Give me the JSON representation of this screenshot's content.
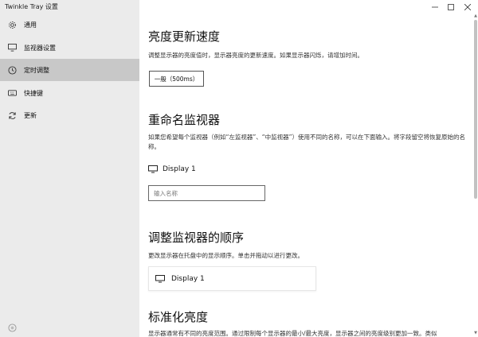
{
  "window": {
    "title": "Twinkle Tray 设置",
    "controls": [
      "minimize-icon",
      "maximize-icon",
      "close-icon"
    ]
  },
  "sidebar": {
    "items": [
      {
        "label": "通用",
        "icon": "gear-icon",
        "active": false
      },
      {
        "label": "监视器设置",
        "icon": "monitor-icon",
        "active": false
      },
      {
        "label": "定时调整",
        "icon": "clock-icon",
        "active": true
      },
      {
        "label": "快捷键",
        "icon": "keyboard-icon",
        "active": false
      },
      {
        "label": "更新",
        "icon": "refresh-icon",
        "active": false
      }
    ],
    "bottom_icon": "info-icon"
  },
  "sections": {
    "brightness_speed": {
      "title": "亮度更新速度",
      "description": "调整显示器的亮度值时，显示器亮度的更新速度。如果显示器闪烁，请增加时间。",
      "selected_value": "一般（500ms）"
    },
    "rename": {
      "title": "重命名监视器",
      "description": "如果您希望每个监视器（例如“左监视器”、“中监视器”）使用不同的名称，可以在下面输入。将字段留空将恢复原始的名称。",
      "monitor_label": "Display 1",
      "input_placeholder": "输入名称",
      "input_value": ""
    },
    "order": {
      "title": "调整监视器的顺序",
      "description": "更改显示器在托盘中的显示顺序。单击并拖动以进行更改。",
      "monitor_label": "Display 1"
    },
    "normalize": {
      "title": "标准化亮度",
      "description": "显示器通常有不同的亮度范围。通过限制每个显示器的最小/最大亮度，显示器之间的亮度级别更加一致。类似"
    }
  }
}
